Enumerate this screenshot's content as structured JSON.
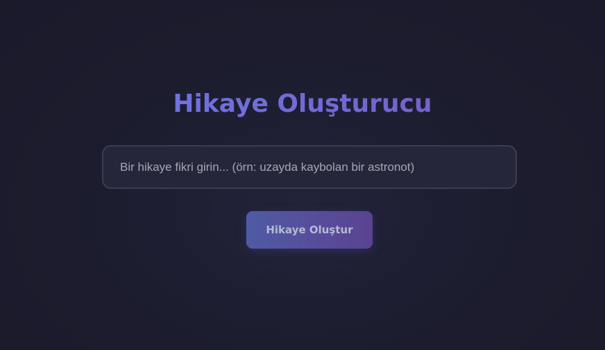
{
  "page": {
    "title": "Hikaye Oluşturucu"
  },
  "story_form": {
    "input_value": "",
    "input_placeholder": "Bir hikaye fikri girin... (örn: uzayda kaybolan bir astronot)",
    "submit_label": "Hikaye Oluştur"
  },
  "colors": {
    "background": "#1c1c2e",
    "title_gradient_start": "#6f7be6",
    "title_gradient_end": "#7a57b8",
    "input_background": "#26263a",
    "input_border": "#3c3c52",
    "button_gradient_start": "#4f5ba4",
    "button_gradient_end": "#5a4391",
    "button_text": "#b6b9d6"
  }
}
